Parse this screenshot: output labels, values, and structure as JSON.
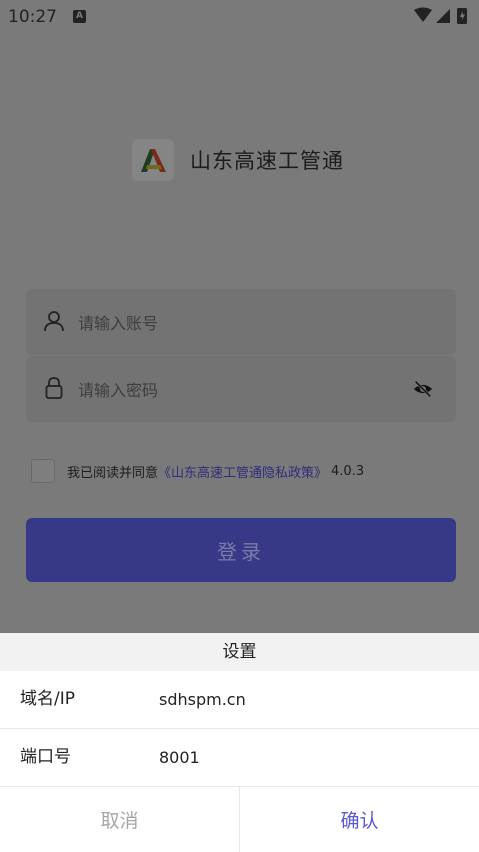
{
  "status_bar": {
    "time": "10:27",
    "a_badge": "A"
  },
  "app": {
    "title": "山东高速工管通"
  },
  "login": {
    "account_placeholder": "请输入账号",
    "password_placeholder": "请输入密码",
    "agree_text": "我已阅读并同意",
    "agree_link": "《山东高速工管通隐私政策》",
    "version": "4.0.3",
    "login_label": "登录"
  },
  "dialog": {
    "title": "设置",
    "rows": [
      {
        "label": "域名/IP",
        "value": "sdhspm.cn"
      },
      {
        "label": "端口号",
        "value": "8001"
      }
    ],
    "cancel_label": "取消",
    "confirm_label": "确认"
  },
  "colors": {
    "primary": "#5a58d6",
    "login_button": "#373886",
    "overlay": "#7a7a7a"
  }
}
